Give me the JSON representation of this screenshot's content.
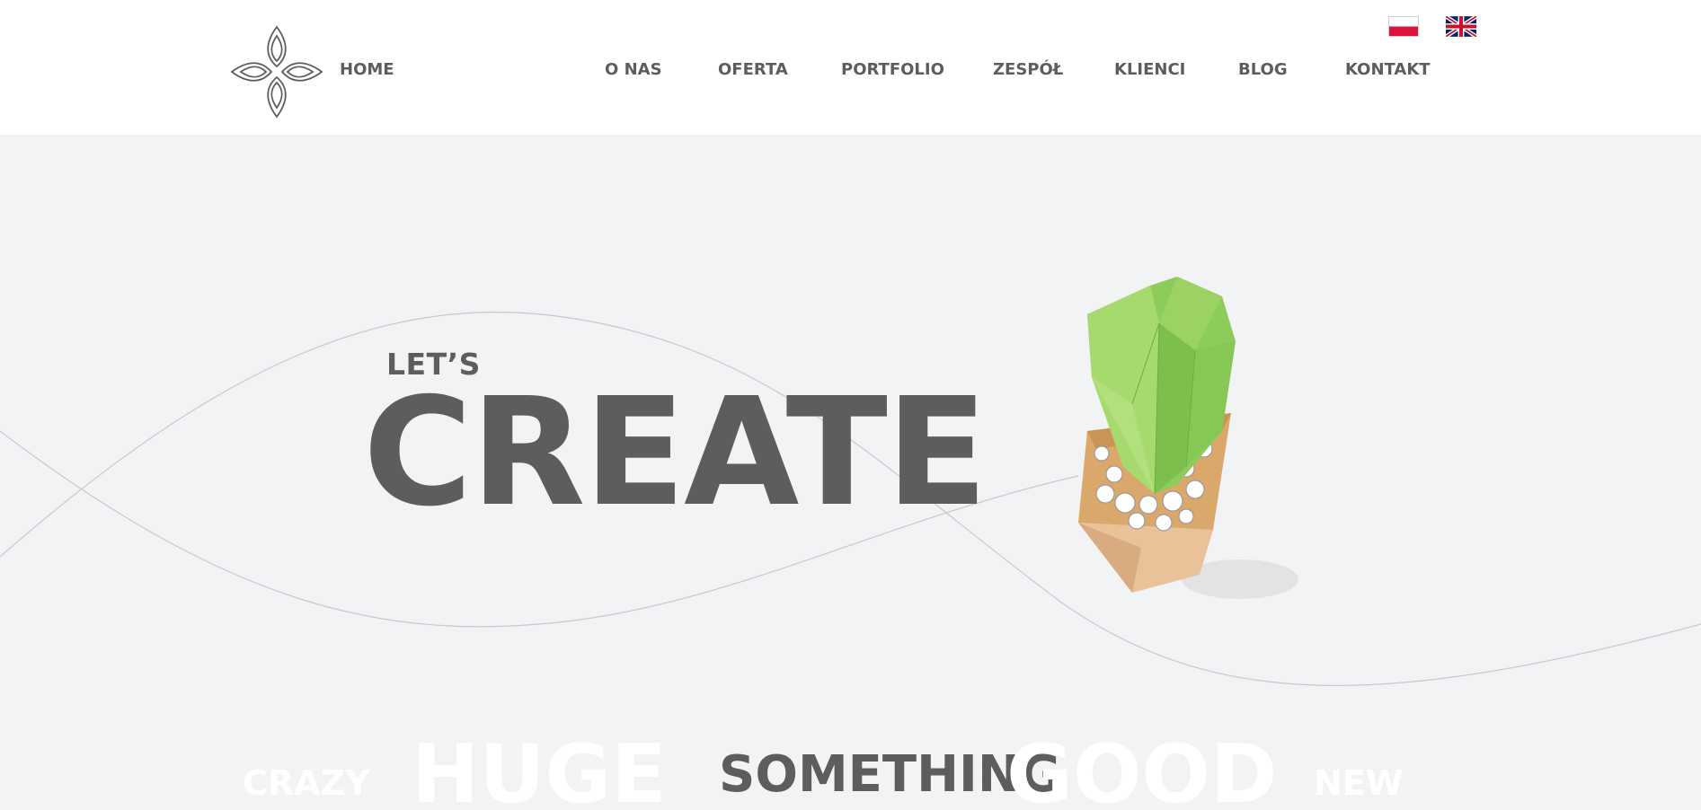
{
  "header": {
    "home_label": "HOME",
    "nav": [
      {
        "label": "O NAS"
      },
      {
        "label": "OFERTA"
      },
      {
        "label": "PORTFOLIO"
      },
      {
        "label": "ZESPÓŁ"
      },
      {
        "label": "KLIENCI"
      },
      {
        "label": "BLOG"
      },
      {
        "label": "KONTAKT"
      }
    ],
    "languages": [
      {
        "name": "polish-flag",
        "colors": [
          "#ffffff",
          "#dc143c"
        ]
      },
      {
        "name": "uk-flag",
        "colors": [
          "#012169",
          "#ffffff",
          "#c8102e"
        ]
      }
    ]
  },
  "hero": {
    "lets": "LET’S",
    "headline": "CREATE",
    "rotating_words": [
      "CRAZY",
      "HUGE",
      "SOMETHING",
      "GOOD",
      "NEW"
    ],
    "active_word": "SOMETHING"
  },
  "colors": {
    "text": "#5b5e5b",
    "background": "#f2f3f5",
    "cactus_green": "#8ccc5a",
    "pot": "#d9a86a"
  }
}
